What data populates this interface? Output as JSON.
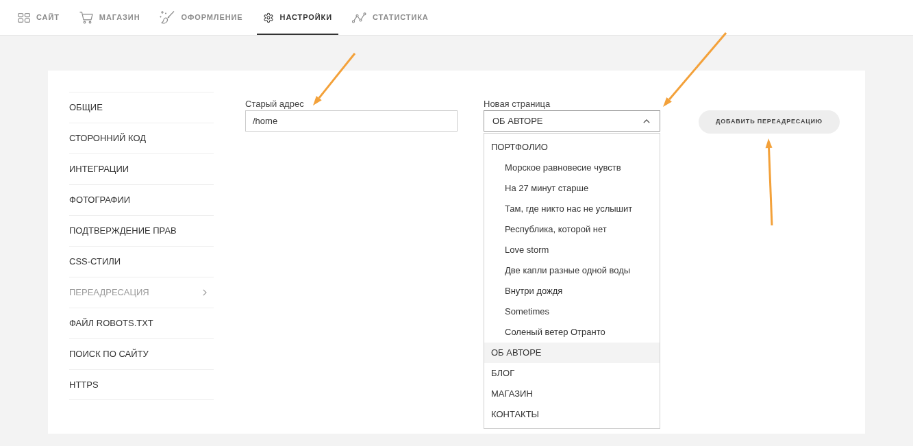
{
  "nav": {
    "tabs": [
      {
        "label": "САЙТ",
        "selected": false
      },
      {
        "label": "МАГАЗИН",
        "selected": false
      },
      {
        "label": "ОФОРМЛЕНИЕ",
        "selected": false
      },
      {
        "label": "НАСТРОЙКИ",
        "selected": true
      },
      {
        "label": "СТАТИСТИКА",
        "selected": false
      }
    ]
  },
  "sidebar": {
    "items": [
      {
        "label": "ОБЩИЕ",
        "selected": false
      },
      {
        "label": "СТОРОННИЙ КОД",
        "selected": false
      },
      {
        "label": "ИНТЕГРАЦИИ",
        "selected": false
      },
      {
        "label": "ФОТОГРАФИИ",
        "selected": false
      },
      {
        "label": "ПОДТВЕРЖДЕНИЕ ПРАВ",
        "selected": false
      },
      {
        "label": "CSS-СТИЛИ",
        "selected": false
      },
      {
        "label": "ПЕРЕАДРЕСАЦИЯ",
        "selected": true
      },
      {
        "label": "ФАЙЛ ROBOTS.TXT",
        "selected": false
      },
      {
        "label": "ПОИСК ПО САЙТУ",
        "selected": false
      },
      {
        "label": "HTTPS",
        "selected": false
      }
    ]
  },
  "redirect_form": {
    "old_address": {
      "label": "Старый адрес",
      "value": "/home"
    },
    "new_page": {
      "label": "Новая страница",
      "value": "ОБ АВТОРЕ",
      "expanded": true,
      "options": [
        {
          "label": "ПОРТФОЛИО",
          "selected": false,
          "children": [
            {
              "label": "Морское равновесие чувств",
              "selected": false
            },
            {
              "label": "На 27 минут старше",
              "selected": false
            },
            {
              "label": "Там, где никто нас не услышит",
              "selected": false
            },
            {
              "label": "Республика, которой нет",
              "selected": false
            },
            {
              "label": "Love storm",
              "selected": false
            },
            {
              "label": "Две капли разные одной воды",
              "selected": false
            },
            {
              "label": "Внутри дождя",
              "selected": false
            },
            {
              "label": "Sometimes",
              "selected": false
            },
            {
              "label": "Соленый ветер Отранто",
              "selected": false
            }
          ]
        },
        {
          "label": "ОБ АВТОРЕ",
          "selected": true
        },
        {
          "label": "БЛОГ",
          "selected": false
        },
        {
          "label": "МАГАЗИН",
          "selected": false
        },
        {
          "label": "КОНТАКТЫ",
          "selected": false
        }
      ]
    },
    "add_button": {
      "label": "ДОБАВИТЬ ПЕРЕАДРЕСАЦИЮ"
    }
  }
}
